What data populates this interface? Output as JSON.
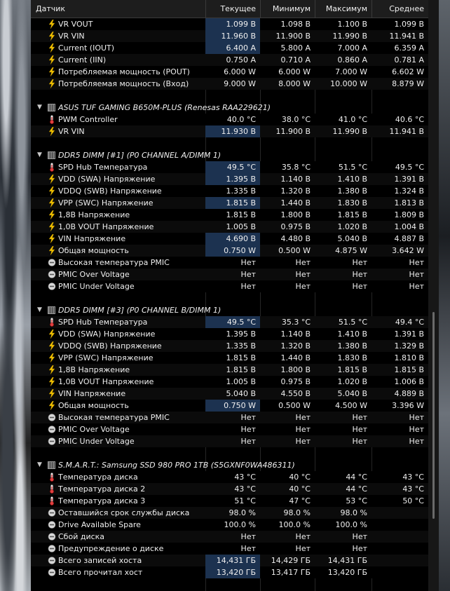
{
  "header": {
    "sensor": "Датчик",
    "current": "Текущее",
    "min": "Минимум",
    "max": "Максимум",
    "avg": "Среднее"
  },
  "rows": [
    {
      "type": "sensor",
      "icon": "voltage",
      "name": "VR VOUT",
      "cur": "1.099 В",
      "min": "1.098 В",
      "max": "1.100 В",
      "avg": "1.099 В",
      "hl": true
    },
    {
      "type": "sensor",
      "icon": "voltage",
      "name": "VR VIN",
      "cur": "11.960 В",
      "min": "11.900 В",
      "max": "11.990 В",
      "avg": "11.941 В",
      "hl": true
    },
    {
      "type": "sensor",
      "icon": "voltage",
      "name": "Current (IOUT)",
      "cur": "6.400 A",
      "min": "5.800 A",
      "max": "7.000 A",
      "avg": "6.359 A",
      "hl": true
    },
    {
      "type": "sensor",
      "icon": "voltage",
      "name": "Current (IIN)",
      "cur": "0.750 A",
      "min": "0.710 A",
      "max": "0.860 A",
      "avg": "0.781 A",
      "hl": false
    },
    {
      "type": "sensor",
      "icon": "voltage",
      "name": "Потребляемая мощность (POUT)",
      "cur": "6.000 W",
      "min": "6.000 W",
      "max": "7.000 W",
      "avg": "6.602 W",
      "hl": false
    },
    {
      "type": "sensor",
      "icon": "voltage",
      "name": "Потребляемая мощность (Вход)",
      "cur": "9.000 W",
      "min": "8.000 W",
      "max": "10.000 W",
      "avg": "8.879 W",
      "hl": false
    },
    {
      "type": "spacer"
    },
    {
      "type": "group",
      "name": "ASUS TUF GAMING B650M-PLUS (Renesas RAA229621)"
    },
    {
      "type": "sensor",
      "icon": "temp",
      "name": "PWM Controller",
      "cur": "40.0 °C",
      "min": "38.0 °C",
      "max": "41.0 °C",
      "avg": "40.6 °C",
      "hl": false
    },
    {
      "type": "sensor",
      "icon": "voltage",
      "name": "VR VIN",
      "cur": "11.930 В",
      "min": "11.900 В",
      "max": "11.990 В",
      "avg": "11.941 В",
      "hl": true
    },
    {
      "type": "spacer"
    },
    {
      "type": "group",
      "name": "DDR5 DIMM [#1] (P0 CHANNEL A/DIMM 1)"
    },
    {
      "type": "sensor",
      "icon": "temp",
      "name": "SPD Hub Температура",
      "cur": "49.5 °C",
      "min": "35.8 °C",
      "max": "51.5 °C",
      "avg": "49.5 °C",
      "hl": true
    },
    {
      "type": "sensor",
      "icon": "voltage",
      "name": "VDD (SWA) Напряжение",
      "cur": "1.395 В",
      "min": "1.140 В",
      "max": "1.410 В",
      "avg": "1.391 В",
      "hl": true
    },
    {
      "type": "sensor",
      "icon": "voltage",
      "name": "VDDQ (SWB) Напряжение",
      "cur": "1.335 В",
      "min": "1.320 В",
      "max": "1.380 В",
      "avg": "1.324 В",
      "hl": false
    },
    {
      "type": "sensor",
      "icon": "voltage",
      "name": "VPP (SWC) Напряжение",
      "cur": "1.815 В",
      "min": "1.440 В",
      "max": "1.830 В",
      "avg": "1.813 В",
      "hl": true
    },
    {
      "type": "sensor",
      "icon": "voltage",
      "name": "1,8В Напряжение",
      "cur": "1.815 В",
      "min": "1.800 В",
      "max": "1.815 В",
      "avg": "1.809 В",
      "hl": false
    },
    {
      "type": "sensor",
      "icon": "voltage",
      "name": "1,0В VOUT Напряжение",
      "cur": "1.005 В",
      "min": "0.975 В",
      "max": "1.020 В",
      "avg": "1.004 В",
      "hl": false
    },
    {
      "type": "sensor",
      "icon": "voltage",
      "name": "VIN Напряжение",
      "cur": "4.690 В",
      "min": "4.480 В",
      "max": "5.040 В",
      "avg": "4.887 В",
      "hl": true
    },
    {
      "type": "sensor",
      "icon": "voltage",
      "name": "Общая мощность",
      "cur": "0.750 W",
      "min": "0.500 W",
      "max": "4.875 W",
      "avg": "3.642 W",
      "hl": true
    },
    {
      "type": "sensor",
      "icon": "status",
      "name": "Высокая температура PMIC",
      "cur": "Нет",
      "min": "Нет",
      "max": "Нет",
      "avg": "Нет",
      "hl": false
    },
    {
      "type": "sensor",
      "icon": "status",
      "name": "PMIC Over Voltage",
      "cur": "Нет",
      "min": "Нет",
      "max": "Нет",
      "avg": "Нет",
      "hl": false
    },
    {
      "type": "sensor",
      "icon": "status",
      "name": "PMIC Under Voltage",
      "cur": "Нет",
      "min": "Нет",
      "max": "Нет",
      "avg": "Нет",
      "hl": false
    },
    {
      "type": "spacer"
    },
    {
      "type": "group",
      "name": "DDR5 DIMM [#3] (P0 CHANNEL B/DIMM 1)"
    },
    {
      "type": "sensor",
      "icon": "temp",
      "name": "SPD Hub Температура",
      "cur": "49.5 °C",
      "min": "35.3 °C",
      "max": "51.5 °C",
      "avg": "49.4 °C",
      "hl": true
    },
    {
      "type": "sensor",
      "icon": "voltage",
      "name": "VDD (SWA) Напряжение",
      "cur": "1.395 В",
      "min": "1.140 В",
      "max": "1.410 В",
      "avg": "1.391 В",
      "hl": false
    },
    {
      "type": "sensor",
      "icon": "voltage",
      "name": "VDDQ (SWB) Напряжение",
      "cur": "1.335 В",
      "min": "1.320 В",
      "max": "1.380 В",
      "avg": "1.329 В",
      "hl": false
    },
    {
      "type": "sensor",
      "icon": "voltage",
      "name": "VPP (SWC) Напряжение",
      "cur": "1.815 В",
      "min": "1.440 В",
      "max": "1.830 В",
      "avg": "1.810 В",
      "hl": false
    },
    {
      "type": "sensor",
      "icon": "voltage",
      "name": "1,8В Напряжение",
      "cur": "1.815 В",
      "min": "1.800 В",
      "max": "1.815 В",
      "avg": "1.815 В",
      "hl": false
    },
    {
      "type": "sensor",
      "icon": "voltage",
      "name": "1,0В VOUT Напряжение",
      "cur": "1.005 В",
      "min": "0.975 В",
      "max": "1.020 В",
      "avg": "1.006 В",
      "hl": false
    },
    {
      "type": "sensor",
      "icon": "voltage",
      "name": "VIN Напряжение",
      "cur": "5.040 В",
      "min": "4.550 В",
      "max": "5.040 В",
      "avg": "4.889 В",
      "hl": false
    },
    {
      "type": "sensor",
      "icon": "voltage",
      "name": "Общая мощность",
      "cur": "0.750 W",
      "min": "0.500 W",
      "max": "4.500 W",
      "avg": "3.396 W",
      "hl": true
    },
    {
      "type": "sensor",
      "icon": "status",
      "name": "Высокая температура PMIC",
      "cur": "Нет",
      "min": "Нет",
      "max": "Нет",
      "avg": "Нет",
      "hl": false
    },
    {
      "type": "sensor",
      "icon": "status",
      "name": "PMIC Over Voltage",
      "cur": "Нет",
      "min": "Нет",
      "max": "Нет",
      "avg": "Нет",
      "hl": false
    },
    {
      "type": "sensor",
      "icon": "status",
      "name": "PMIC Under Voltage",
      "cur": "Нет",
      "min": "Нет",
      "max": "Нет",
      "avg": "Нет",
      "hl": false
    },
    {
      "type": "spacer"
    },
    {
      "type": "group",
      "name": "S.M.A.R.T.: Samsung SSD 980 PRO 1TB (S5GXNF0WA486311)"
    },
    {
      "type": "sensor",
      "icon": "temp",
      "name": "Температура диска",
      "cur": "43 °C",
      "min": "40 °C",
      "max": "44 °C",
      "avg": "43 °C",
      "hl": false
    },
    {
      "type": "sensor",
      "icon": "temp",
      "name": "Температура диска 2",
      "cur": "43 °C",
      "min": "40 °C",
      "max": "44 °C",
      "avg": "43 °C",
      "hl": false
    },
    {
      "type": "sensor",
      "icon": "temp",
      "name": "Температура диска 3",
      "cur": "51 °C",
      "min": "47 °C",
      "max": "53 °C",
      "avg": "50 °C",
      "hl": false
    },
    {
      "type": "sensor",
      "icon": "status",
      "name": "Оставшийся срок службы диска",
      "cur": "98.0 %",
      "min": "98.0 %",
      "max": "98.0 %",
      "avg": "",
      "hl": false
    },
    {
      "type": "sensor",
      "icon": "status",
      "name": "Drive Available Spare",
      "cur": "100.0 %",
      "min": "100.0 %",
      "max": "100.0 %",
      "avg": "",
      "hl": false
    },
    {
      "type": "sensor",
      "icon": "status",
      "name": "Сбой диска",
      "cur": "Нет",
      "min": "Нет",
      "max": "Нет",
      "avg": "",
      "hl": false
    },
    {
      "type": "sensor",
      "icon": "status",
      "name": "Предупреждение о диске",
      "cur": "Нет",
      "min": "Нет",
      "max": "Нет",
      "avg": "",
      "hl": false
    },
    {
      "type": "sensor",
      "icon": "status",
      "name": "Всего записей хоста",
      "cur": "14,431 ГБ",
      "min": "14,429 ГБ",
      "max": "14,431 ГБ",
      "avg": "",
      "hl": true
    },
    {
      "type": "sensor",
      "icon": "status",
      "name": "Всего прочитал хост",
      "cur": "13,420 ГБ",
      "min": "13,417 ГБ",
      "max": "13,420 ГБ",
      "avg": "",
      "hl": true
    }
  ],
  "colors": {
    "highlight": "#1c3250",
    "voltage_icon": "#f2c200",
    "temp_icon": "#e04040"
  }
}
